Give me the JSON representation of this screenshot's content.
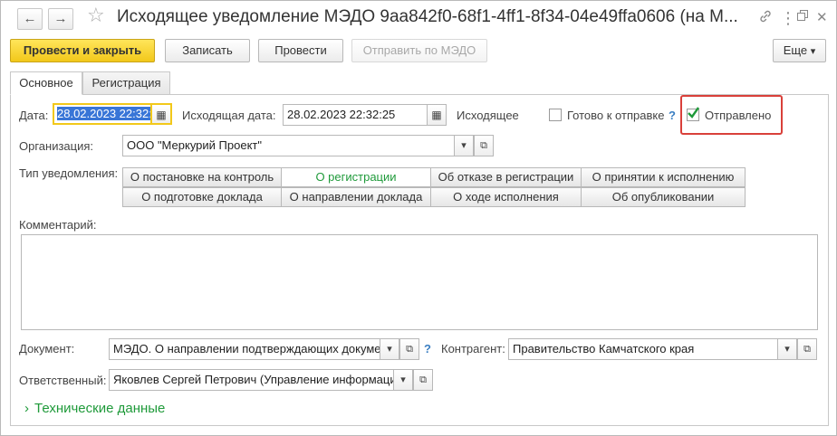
{
  "window": {
    "title": "Исходящее уведомление МЭДО 9aa842f0-68f1-4ff1-8f34-04e49ffa0606 (на М...",
    "icons": {
      "back": "arrow-left-icon",
      "forward": "arrow-right-icon",
      "favorite": "star-icon",
      "link": "link-icon",
      "more": "kebab-icon",
      "restore": "restore-window-icon",
      "close": "close-icon"
    }
  },
  "toolbar": {
    "post_close": "Провести и закрыть",
    "save": "Записать",
    "post": "Провести",
    "send": "Отправить по МЭДО",
    "more": "Еще",
    "more_arrow": "▾"
  },
  "tabs": [
    {
      "label": "Основное"
    },
    {
      "label": "Регистрация"
    }
  ],
  "form": {
    "date_label": "Дата:",
    "date_value": "28.02.2023 22:32:",
    "out_date_label": "Исходящая дата:",
    "out_date_value": "28.02.2023 22:32:25",
    "direction": "Исходящее",
    "ready_label": "Готово к отправке",
    "ready_checked": false,
    "help_mark": "?",
    "sent_label": "Отправлено",
    "sent_checked": true,
    "org_label": "Организация:",
    "org_value": "ООО \"Меркурий Проект\"",
    "type_label": "Тип уведомления:",
    "types_row1": [
      "О постановке на контроль",
      "О регистрации",
      "Об отказе в регистрации",
      "О принятии к исполнению"
    ],
    "types_row2": [
      "О подготовке доклада",
      "О направлении доклада",
      "О ходе исполнения",
      "Об опубликовании"
    ],
    "selected_type": "О регистрации",
    "comment_label": "Комментарий:",
    "comment_value": "",
    "doc_label": "Документ:",
    "doc_value": "МЭДО. О направлении подтверждающих докуме",
    "counterparty_label": "Контрагент:",
    "counterparty_value": "Правительство Камчатского края",
    "responsible_label": "Ответственный:",
    "responsible_value": "Яковлев Сергей Петрович (Управление информаци",
    "tech_section": "Технические данные"
  },
  "colors": {
    "accent_yellow": "#f2c81a",
    "selected_green": "#1f9a3a",
    "highlight_red": "#d9403a",
    "help_blue": "#3a7ec2",
    "selection_blue": "#3875d7"
  }
}
